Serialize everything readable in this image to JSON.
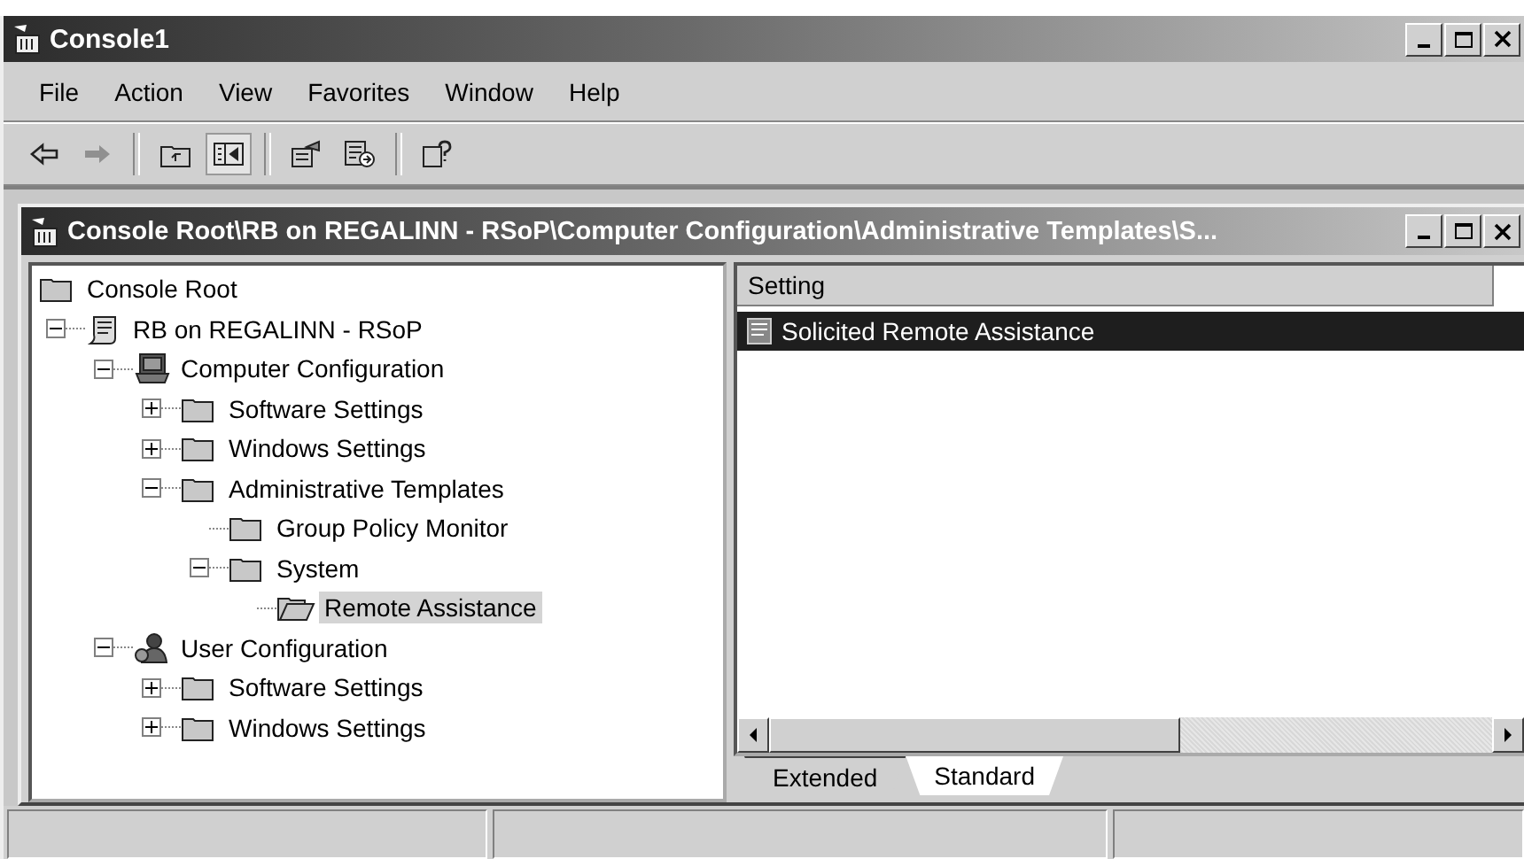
{
  "window": {
    "title": "Console1"
  },
  "menu": [
    "File",
    "Action",
    "View",
    "Favorites",
    "Window",
    "Help"
  ],
  "toolbar": [
    {
      "kind": "back",
      "disabled": false,
      "pressed": false
    },
    {
      "kind": "forward",
      "disabled": true,
      "pressed": false
    },
    {
      "kind": "separator"
    },
    {
      "kind": "up",
      "disabled": false,
      "pressed": false
    },
    {
      "kind": "tree",
      "disabled": false,
      "pressed": true
    },
    {
      "kind": "separator"
    },
    {
      "kind": "properties",
      "disabled": false,
      "pressed": false
    },
    {
      "kind": "export",
      "disabled": false,
      "pressed": false
    },
    {
      "kind": "separator"
    },
    {
      "kind": "help",
      "disabled": false,
      "pressed": false
    }
  ],
  "child_window": {
    "title": "Console Root\\RB on REGALINN - RSoP\\Computer Configuration\\Administrative Templates\\S..."
  },
  "tree": [
    {
      "label": "Console Root",
      "kind": "folder",
      "selected": false,
      "children": [
        {
          "label": "RB on REGALINN - RSoP",
          "kind": "rsop",
          "expanded": true,
          "selected": false,
          "children": [
            {
              "label": "Computer Configuration",
              "kind": "computer",
              "expanded": true,
              "selected": false,
              "children": [
                {
                  "label": "Software Settings",
                  "kind": "folder",
                  "expanded": false,
                  "selected": false
                },
                {
                  "label": "Windows Settings",
                  "kind": "folder",
                  "expanded": false,
                  "selected": false
                },
                {
                  "label": "Administrative Templates",
                  "kind": "folder",
                  "expanded": true,
                  "selected": false,
                  "children": [
                    {
                      "label": "Group Policy Monitor",
                      "kind": "folder",
                      "selected": false
                    },
                    {
                      "label": "System",
                      "kind": "folder",
                      "expanded": true,
                      "selected": false,
                      "children": [
                        {
                          "label": "Remote Assistance",
                          "kind": "folder",
                          "selected": true
                        }
                      ]
                    }
                  ]
                }
              ]
            },
            {
              "label": "User Configuration",
              "kind": "user",
              "expanded": true,
              "selected": false,
              "children": [
                {
                  "label": "Software Settings",
                  "kind": "folder",
                  "expanded": false,
                  "selected": false
                },
                {
                  "label": "Windows Settings",
                  "kind": "folder",
                  "expanded": false,
                  "selected": false
                }
              ]
            }
          ]
        }
      ]
    }
  ],
  "list": {
    "columns": [
      "Setting"
    ],
    "rows": [
      {
        "setting": "Solicited Remote Assistance",
        "selected": true
      }
    ]
  },
  "tabs": [
    {
      "label": "Extended",
      "selected": false
    },
    {
      "label": "Standard",
      "selected": true
    }
  ]
}
